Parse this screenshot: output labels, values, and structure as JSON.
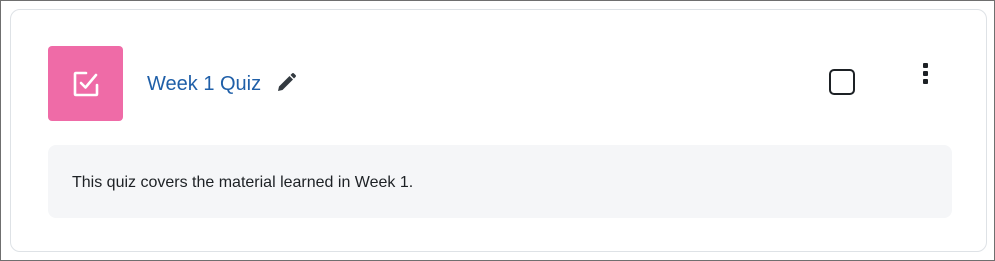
{
  "activity": {
    "icon": "quiz-check-icon",
    "icon_color": "#ef6ba7",
    "name": "Week 1 Quiz",
    "name_color": "#1f5fa8",
    "edit_icon": "pencil-icon",
    "completion_icon": "checkbox-unchecked-icon",
    "menu_icon": "kebab-menu-icon",
    "description": "This quiz covers the material learned in Week 1."
  }
}
